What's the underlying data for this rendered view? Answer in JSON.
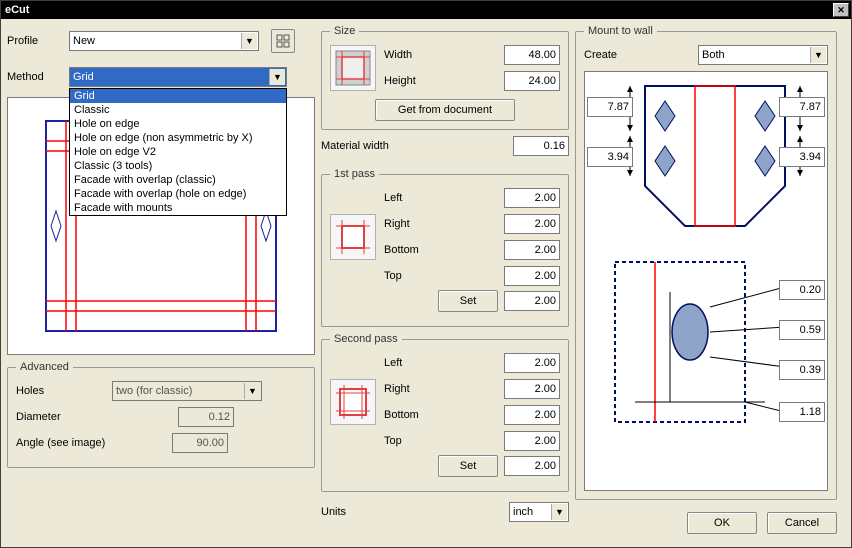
{
  "window": {
    "title": "eCut"
  },
  "profile": {
    "label": "Profile",
    "value": "New"
  },
  "method": {
    "label": "Method",
    "value": "Grid",
    "options": [
      "Grid",
      "Classic",
      "Hole on edge",
      "Hole on edge (non asymmetric by X)",
      "Hole on edge V2",
      "Classic (3 tools)",
      "Facade with overlap (classic)",
      "Facade with overlap (hole on edge)",
      "Facade with mounts"
    ]
  },
  "advanced": {
    "legend": "Advanced",
    "holes_label": "Holes",
    "holes_value": "two (for classic)",
    "diameter_label": "Diameter",
    "diameter_value": "0.12",
    "angle_label": "Angle (see image)",
    "angle_value": "90.00"
  },
  "size": {
    "legend": "Size",
    "width_label": "Width",
    "width_value": "48.00",
    "height_label": "Height",
    "height_value": "24.00",
    "get_doc": "Get from document"
  },
  "material": {
    "label": "Material width",
    "value": "0.16"
  },
  "pass1": {
    "legend": "1st pass",
    "left_label": "Left",
    "left": "2.00",
    "right_label": "Right",
    "right": "2.00",
    "bottom_label": "Bottom",
    "bottom": "2.00",
    "top_label": "Top",
    "top": "2.00",
    "set": "Set",
    "set_val": "2.00"
  },
  "pass2": {
    "legend": "Second pass",
    "left_label": "Left",
    "left": "2.00",
    "right_label": "Right",
    "right": "2.00",
    "bottom_label": "Bottom",
    "bottom": "2.00",
    "top_label": "Top",
    "top": "2.00",
    "set": "Set",
    "set_val": "2.00"
  },
  "units": {
    "label": "Units",
    "value": "inch"
  },
  "mount": {
    "legend": "Mount to wall",
    "create_label": "Create",
    "create_value": "Both",
    "dims": {
      "topL": "7.87",
      "topR": "7.87",
      "botL": "3.94",
      "botR": "3.94",
      "d1": "0.20",
      "d2": "0.59",
      "d3": "0.39",
      "d4": "1.18"
    }
  },
  "buttons": {
    "ok": "OK",
    "cancel": "Cancel"
  }
}
